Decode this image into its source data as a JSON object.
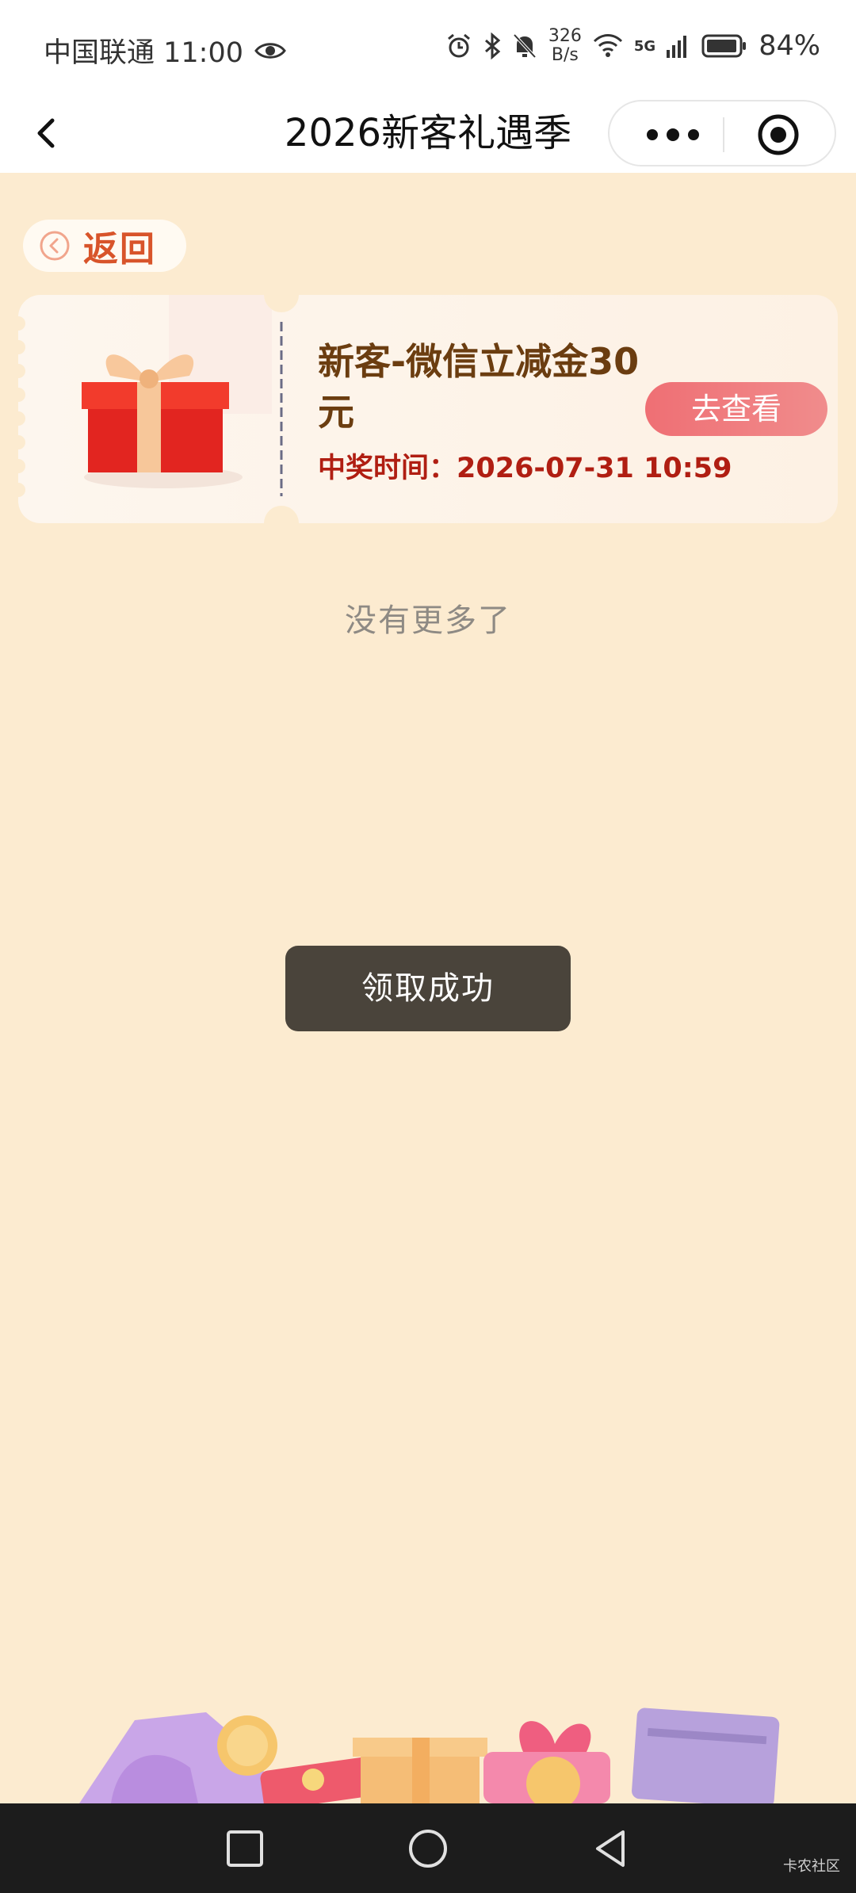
{
  "status_bar": {
    "carrier_time": "中国联通 11:00",
    "net_speed_value": "326",
    "net_speed_unit": "B/s",
    "network": "5G",
    "battery": "84%"
  },
  "nav": {
    "title": "2026新客礼遇季"
  },
  "back": {
    "label": "返回"
  },
  "coupon": {
    "title": "新客-微信立减金30元",
    "time_label": "中奖时间：",
    "time_value": "2026-07-31 10:59",
    "button_label": "去查看"
  },
  "list_end": "没有更多了",
  "toast": "领取成功",
  "watermark": "卡农社区",
  "colors": {
    "page_bg": "#fcebd0",
    "accent_red": "#b01e12",
    "title_brown": "#6b3d10",
    "button_pink": "#ef6f74",
    "toast_bg": "#4a443b"
  }
}
